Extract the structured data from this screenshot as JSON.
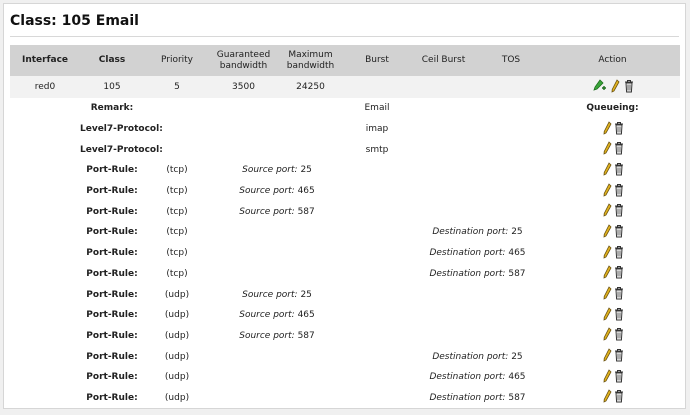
{
  "title": "Class: 105 Email",
  "headers": {
    "interface": "Interface",
    "class": "Class",
    "priority": "Priority",
    "guaranteed_1": "Guaranteed",
    "guaranteed_2": "bandwidth",
    "maximum_1": "Maximum",
    "maximum_2": "bandwidth",
    "burst": "Burst",
    "ceil_burst": "Ceil Burst",
    "tos": "TOS",
    "action": "Action"
  },
  "main_row": {
    "interface": "red0",
    "class": "105",
    "priority": "5",
    "guaranteed": "3500",
    "maximum": "24250"
  },
  "remark": {
    "label": "Remark:",
    "value": "Email",
    "queueing": "Queueing:"
  },
  "protocols": [
    {
      "label": "Level7-Protocol:",
      "value": "imap"
    },
    {
      "label": "Level7-Protocol:",
      "value": "smtp"
    }
  ],
  "port_rules": [
    {
      "label": "Port-Rule:",
      "proto": "(tcp)",
      "src_label": "Source port:",
      "src_port": "25",
      "dst_label": "",
      "dst_port": ""
    },
    {
      "label": "Port-Rule:",
      "proto": "(tcp)",
      "src_label": "Source port:",
      "src_port": "465",
      "dst_label": "",
      "dst_port": ""
    },
    {
      "label": "Port-Rule:",
      "proto": "(tcp)",
      "src_label": "Source port:",
      "src_port": "587",
      "dst_label": "",
      "dst_port": ""
    },
    {
      "label": "Port-Rule:",
      "proto": "(tcp)",
      "src_label": "",
      "src_port": "",
      "dst_label": "Destination port:",
      "dst_port": "25"
    },
    {
      "label": "Port-Rule:",
      "proto": "(tcp)",
      "src_label": "",
      "src_port": "",
      "dst_label": "Destination port:",
      "dst_port": "465"
    },
    {
      "label": "Port-Rule:",
      "proto": "(tcp)",
      "src_label": "",
      "src_port": "",
      "dst_label": "Destination port:",
      "dst_port": "587"
    },
    {
      "label": "Port-Rule:",
      "proto": "(udp)",
      "src_label": "Source port:",
      "src_port": "25",
      "dst_label": "",
      "dst_port": ""
    },
    {
      "label": "Port-Rule:",
      "proto": "(udp)",
      "src_label": "Source port:",
      "src_port": "465",
      "dst_label": "",
      "dst_port": ""
    },
    {
      "label": "Port-Rule:",
      "proto": "(udp)",
      "src_label": "Source port:",
      "src_port": "587",
      "dst_label": "",
      "dst_port": ""
    },
    {
      "label": "Port-Rule:",
      "proto": "(udp)",
      "src_label": "",
      "src_port": "",
      "dst_label": "Destination port:",
      "dst_port": "25"
    },
    {
      "label": "Port-Rule:",
      "proto": "(udp)",
      "src_label": "",
      "src_port": "",
      "dst_label": "Destination port:",
      "dst_port": "465"
    },
    {
      "label": "Port-Rule:",
      "proto": "(udp)",
      "src_label": "",
      "src_port": "",
      "dst_label": "Destination port:",
      "dst_port": "587"
    }
  ],
  "icons": {
    "add": "add-subclass-icon",
    "edit": "pencil-icon",
    "delete": "trash-icon"
  },
  "colors": {
    "header_bg": "#d2d2d2",
    "row_bg": "#f2f2f2",
    "pencil": "#e0b21e",
    "add_green": "#3aa53a"
  }
}
